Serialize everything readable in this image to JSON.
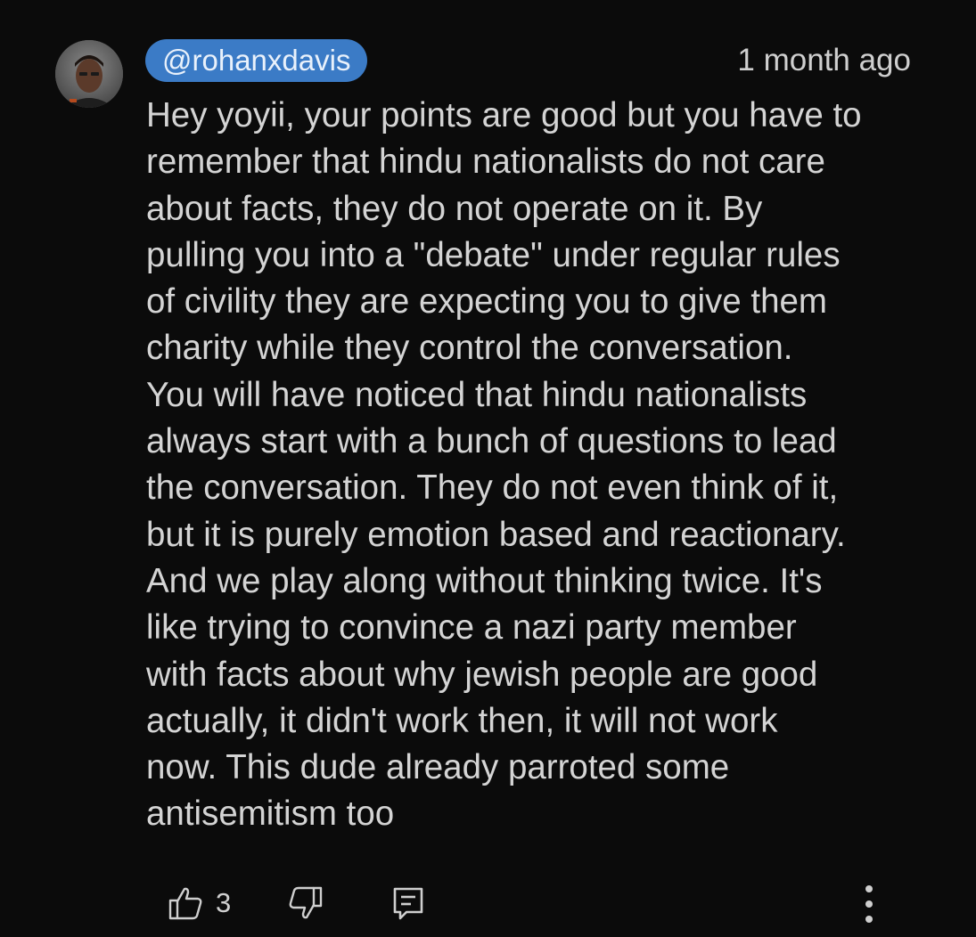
{
  "comment": {
    "author": "@rohanxdavis",
    "timestamp": "1 month ago",
    "body_lines": [
      "Hey yoyii, your points are good but you have to",
      "remember that hindu nationalists do not care",
      "about facts, they do not operate on it. By",
      "pulling you into a \"debate\" under regular rules",
      "of civility they are expecting you to give them",
      "charity while they control the conversation.",
      "You will have noticed that hindu nationalists",
      "always start with a bunch of questions to lead",
      "the conversation. They do not even think of it,",
      "but it is purely emotion based and reactionary.",
      "And we play along without thinking twice. It's",
      "like trying to convince a nazi party member",
      "with facts about why jewish people are good",
      "actually, it didn't work then, it will not work",
      "now. This dude already parroted some",
      "antisemitism too"
    ],
    "like_count": "3"
  },
  "icons": {
    "avatar": "avatar",
    "like": "thumbs-up-icon",
    "dislike": "thumbs-down-icon",
    "reply": "reply-icon",
    "more": "more-vertical-icon"
  },
  "colors": {
    "background": "#0b0b0b",
    "author_chip": "#3b7bc6",
    "text": "#d4d4d4"
  }
}
